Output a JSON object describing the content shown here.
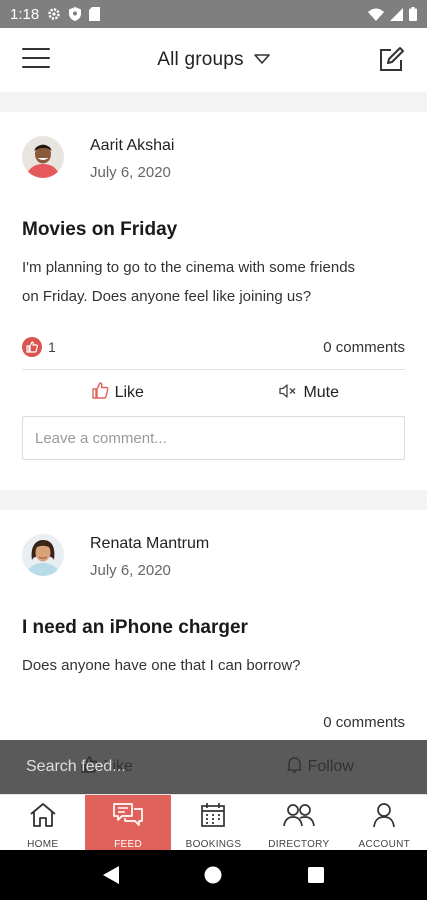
{
  "status_bar": {
    "time": "1:18",
    "icons_left": [
      "gear-icon",
      "shield-icon",
      "sd-card-icon"
    ],
    "icons_right": [
      "wifi-icon",
      "signal-icon",
      "battery-icon"
    ]
  },
  "app_bar": {
    "title": "All groups",
    "icons": [
      "menu-icon",
      "chevron-down-icon",
      "compose-icon"
    ]
  },
  "posts": [
    {
      "author": "Aarit Akshai",
      "date": "July 6, 2020",
      "title": "Movies on Friday",
      "body_line1": "I'm planning to go to the cinema with some friends",
      "body_line2": "on Friday. Does anyone feel like joining us?",
      "like_count": "1",
      "comments": "0 comments",
      "like_label": "Like",
      "mute_label": "Mute",
      "comment_placeholder": "Leave a comment..."
    },
    {
      "author": "Renata Mantrum",
      "date": "July 6, 2020",
      "title": "I need an iPhone charger",
      "body": "Does anyone have one that I can borrow?",
      "comments": "0 comments",
      "like_label": "Like",
      "follow_label": "Follow"
    }
  ],
  "search": {
    "placeholder": "Search feed..."
  },
  "tabs": [
    {
      "label": "HOME",
      "icon": "home-icon",
      "active": false
    },
    {
      "label": "FEED",
      "icon": "chat-icon",
      "active": true
    },
    {
      "label": "BOOKINGS",
      "icon": "calendar-icon",
      "active": false
    },
    {
      "label": "DIRECTORY",
      "icon": "people-icon",
      "active": false
    },
    {
      "label": "ACCOUNT",
      "icon": "person-icon",
      "active": false
    }
  ],
  "colors": {
    "accent": "#e0625a",
    "status_bar": "#7f7f7f",
    "feed_background": "#f3f3f3",
    "search_overlay": "#5a5a5a"
  }
}
